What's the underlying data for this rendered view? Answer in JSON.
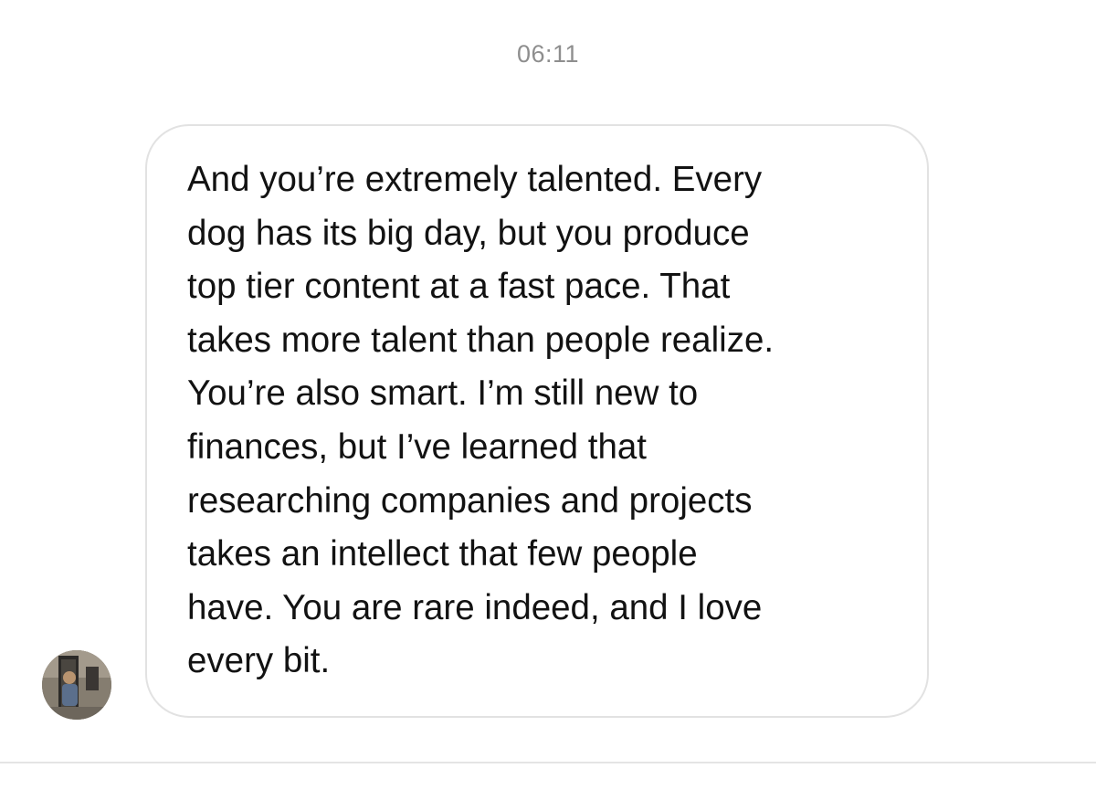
{
  "thread": {
    "timestamp": "06:11"
  },
  "message": {
    "sender_avatar_icon": "profile-photo-avatar",
    "lines": [
      "And you’re extremely talented. Every",
      "dog has its big day, but you produce",
      "top tier content at a fast pace. That",
      "takes more talent than people realize.",
      "You’re also smart. I’m still new to",
      "finances, but I’ve learned that",
      "researching companies and projects",
      "takes an intellect that few people",
      "have. You are rare indeed, and I love",
      "every bit."
    ]
  },
  "colors": {
    "timestamp": "#8e8e8e",
    "bubble_border": "#e2e2e2",
    "text": "#121212",
    "divider": "#e4e4e4"
  }
}
